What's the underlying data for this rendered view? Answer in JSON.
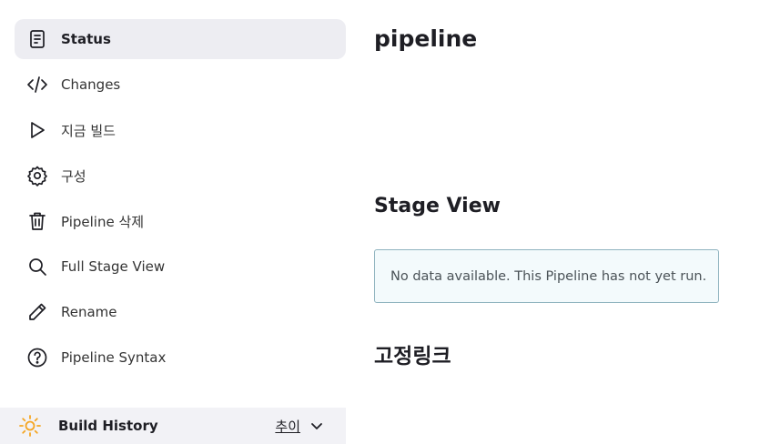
{
  "sidebar": {
    "items": [
      {
        "label": "Status",
        "icon": "status-document-icon"
      },
      {
        "label": "Changes",
        "icon": "code-brackets-icon"
      },
      {
        "label": "지금 빌드",
        "icon": "play-icon"
      },
      {
        "label": "구성",
        "icon": "gear-icon"
      },
      {
        "label": "Pipeline 삭제",
        "icon": "trash-icon"
      },
      {
        "label": "Full Stage View",
        "icon": "search-icon"
      },
      {
        "label": "Rename",
        "icon": "pencil-icon"
      },
      {
        "label": "Pipeline Syntax",
        "icon": "help-circle-icon"
      }
    ]
  },
  "build_history": {
    "title": "Build History",
    "trend_label": "추이",
    "icon": "sun-icon"
  },
  "main": {
    "title": "pipeline",
    "stage_view_title": "Stage View",
    "stage_view_notice": "No data available. This Pipeline has not yet run.",
    "permalinks_title": "고정링크"
  },
  "colors": {
    "active_bg": "#ededf2",
    "notice_border": "#8fb3bf",
    "notice_bg": "#f3fafc",
    "sun": "#f5a623"
  }
}
